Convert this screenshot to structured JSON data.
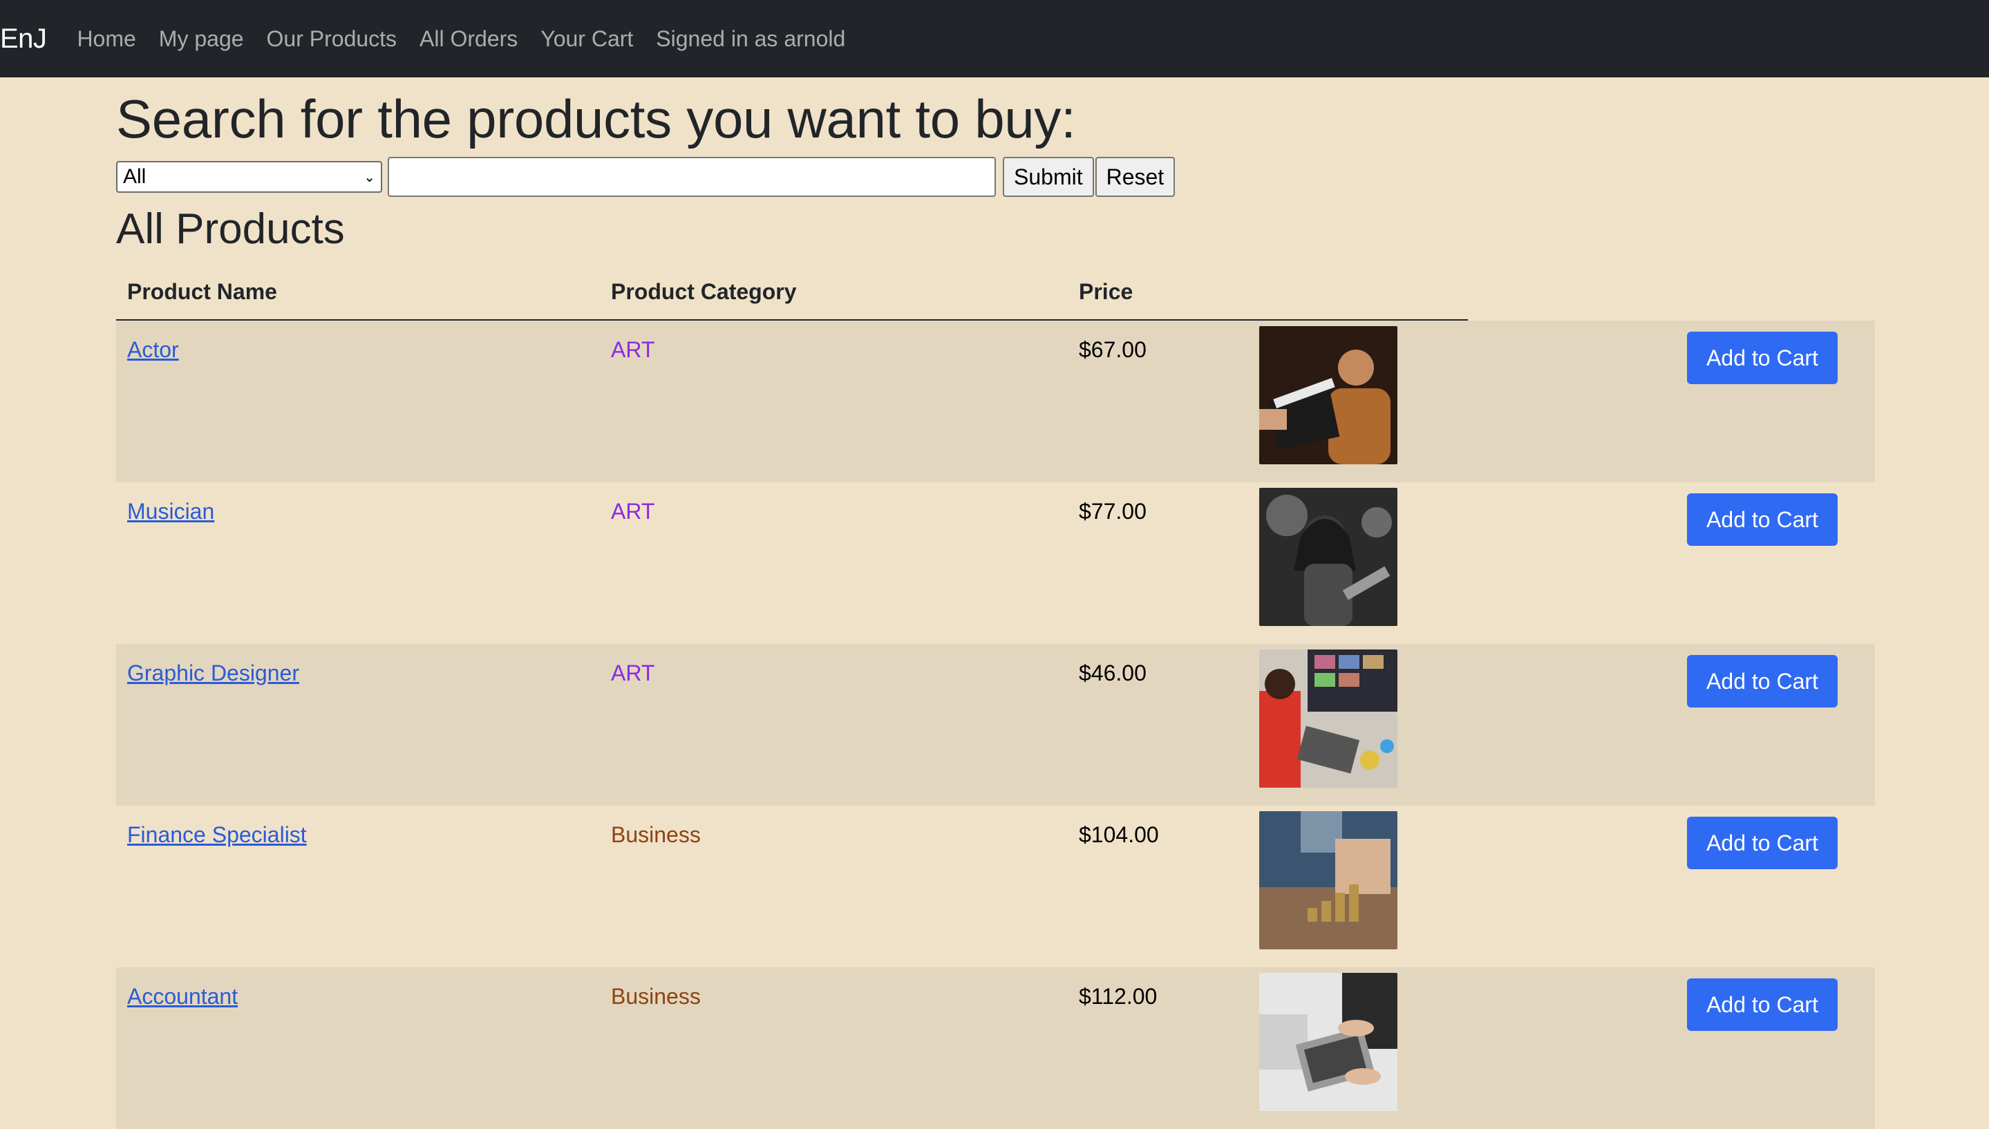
{
  "navbar": {
    "brand": "EnJ",
    "links": [
      {
        "label": "Home"
      },
      {
        "label": "My page"
      },
      {
        "label": "Our Products"
      },
      {
        "label": "All Orders"
      },
      {
        "label": "Your Cart"
      }
    ],
    "signed_in": "Signed in as arnold"
  },
  "search": {
    "title": "Search for the products you want to buy:",
    "category_value": "All",
    "input_value": "",
    "submit_label": "Submit",
    "reset_label": "Reset"
  },
  "products": {
    "title": "All Products",
    "headers": {
      "name": "Product Name",
      "category": "Product Category",
      "price": "Price"
    },
    "add_label": "Add to Cart",
    "rows": [
      {
        "name": "Actor",
        "category": "ART",
        "price": "$67.00"
      },
      {
        "name": "Musician",
        "category": "ART",
        "price": "$77.00"
      },
      {
        "name": "Graphic Designer",
        "category": "ART",
        "price": "$46.00"
      },
      {
        "name": "Finance Specialist",
        "category": "Business",
        "price": "$104.00"
      },
      {
        "name": "Accountant",
        "category": "Business",
        "price": "$112.00"
      }
    ]
  },
  "colors": {
    "navbar_bg": "#212529",
    "page_bg": "#f0e2c8",
    "stripe_bg": "#e3d6bf",
    "link": "#2a5bd7",
    "art_category": "#8a2be2",
    "business_category": "#8b4513",
    "primary_button": "#2f6af3"
  }
}
